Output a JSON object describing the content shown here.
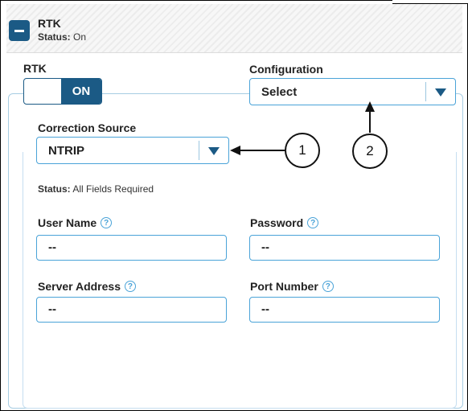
{
  "header": {
    "title": "RTK",
    "status_label": "Status:",
    "status_value": "On"
  },
  "rtk": {
    "label": "RTK",
    "toggle_value": "ON"
  },
  "configuration": {
    "label": "Configuration",
    "selected": "Select"
  },
  "correction_source": {
    "label": "Correction Source",
    "selected": "NTRIP"
  },
  "form_status": {
    "label": "Status:",
    "value": "All Fields Required"
  },
  "fields": {
    "user_name": {
      "label": "User Name",
      "value": "--"
    },
    "password": {
      "label": "Password",
      "value": "--"
    },
    "server_address": {
      "label": "Server Address",
      "value": "--"
    },
    "port_number": {
      "label": "Port Number",
      "value": "--"
    }
  },
  "help_glyph": "?",
  "callouts": [
    "1",
    "2"
  ],
  "colors": {
    "accent": "#1b5a85",
    "border": "#4aa3d8"
  }
}
